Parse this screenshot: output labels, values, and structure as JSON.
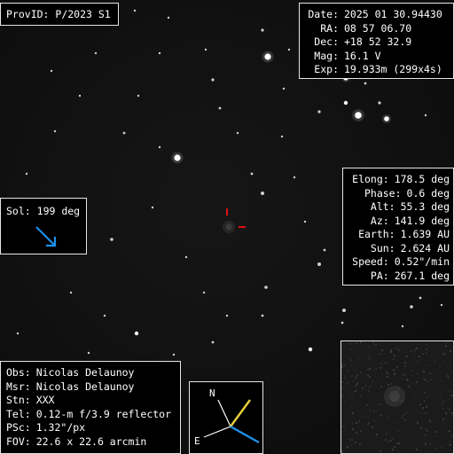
{
  "provid": {
    "label": "ProvID:",
    "value": "P/2023 S1"
  },
  "observation": {
    "rows": [
      {
        "key": "Date:",
        "value": "2025 01 30.94430"
      },
      {
        "key": "RA:",
        "value": "08 57 06.70"
      },
      {
        "key": "Dec:",
        "value": "+18 52 32.9"
      },
      {
        "key": "Mag:",
        "value": "16.1 V"
      },
      {
        "key": "Exp:",
        "value": "19.933m (299x4s)"
      }
    ]
  },
  "geometry": {
    "rows": [
      {
        "key": "Elong:",
        "value": "178.5 deg"
      },
      {
        "key": "Phase:",
        "value": "0.6 deg"
      },
      {
        "key": "Alt:",
        "value": "55.3 deg"
      },
      {
        "key": "Az:",
        "value": "141.9 deg"
      },
      {
        "key": "Earth:",
        "value": "1.639 AU"
      },
      {
        "key": "Sun:",
        "value": "2.624 AU"
      },
      {
        "key": "Speed:",
        "value": "0.52\"/min"
      },
      {
        "key": "PA:",
        "value": "267.1 deg"
      }
    ]
  },
  "sol": {
    "label": "Sol:",
    "value": "199 deg",
    "arrow_color": "#1e90e8"
  },
  "credits": {
    "rows": [
      {
        "key": "Obs:",
        "value": "Nicolas Delaunoy"
      },
      {
        "key": "Msr:",
        "value": "Nicolas Delaunoy"
      },
      {
        "key": "Stn:",
        "value": "XXX"
      },
      {
        "key": "Tel:",
        "value": "0.12-m f/3.9 reflector"
      },
      {
        "key": "PSc:",
        "value": "1.32\"/px"
      },
      {
        "key": "FOV:",
        "value": "22.6 x 22.6 arcmin"
      }
    ]
  },
  "compass": {
    "north_label": "N",
    "east_label": "E",
    "motion_color": "#e8d23a",
    "sun_color": "#1e90e8",
    "axis_color": "#ffffff"
  },
  "target_marker": {
    "color": "#e01010"
  }
}
